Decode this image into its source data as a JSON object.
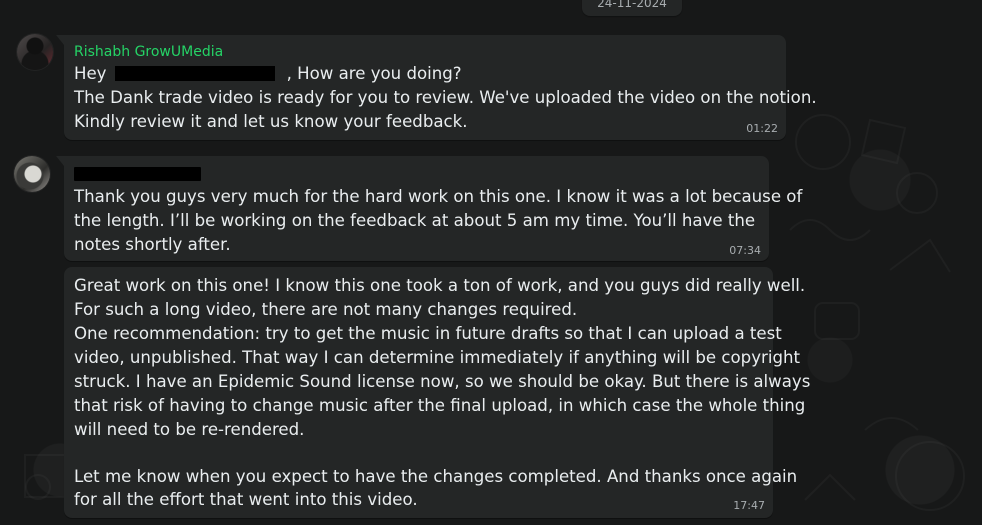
{
  "chat": {
    "date_separator": "24-11-2024",
    "messages": [
      {
        "sender_name": "Rishabh GrowUMedia",
        "greeting_prefix": "Hey",
        "greeting_suffix": ", How are you doing?",
        "lines": [
          "The Dank trade video is ready for you to review. We've uploaded the video on the notion.",
          "Kindly review it and let us know your feedback."
        ],
        "time": "01:22"
      },
      {
        "lines": [
          "Thank you guys very much for the hard work on this one. I know it was a lot because of",
          "the length. I’ll be working on the feedback at about 5 am my time. You’ll have the",
          "notes shortly after."
        ],
        "time": "07:34"
      },
      {
        "lines": [
          "Great work on this one! I know this one took a ton of work, and you guys did really well.",
          "For such a long video, there are not many changes required.",
          "One recommendation: try to get the music in future drafts so that I can upload a test",
          "video, unpublished. That way I can determine immediately if anything will be copyright",
          "struck. I have an Epidemic Sound license now, so we should be okay. But there is always",
          "that risk of having to change music after the final upload, in which case the whole thing",
          "will need to be re-rendered.",
          "",
          "Let me know when you expect to have the changes completed. And thanks once again",
          "for all the effort that went into this video."
        ],
        "time": "17:47"
      }
    ]
  },
  "colors": {
    "background": "#171818",
    "bubble": "#242626",
    "text": "#e9edef",
    "sender": "#25d366",
    "time": "#a8adb0"
  },
  "icons": [
    "avatar-rishabh",
    "avatar-recipient",
    "chat-doodle-pattern"
  ]
}
